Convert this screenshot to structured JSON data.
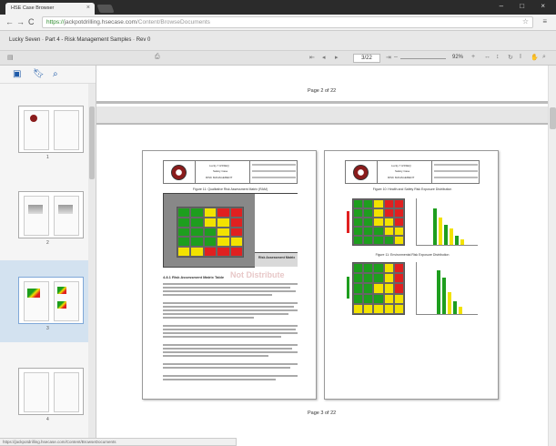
{
  "browser": {
    "tab_title": "HSE Case Browser",
    "tab_close": "×",
    "window_controls": "– □ ×",
    "back": "←",
    "forward": "→",
    "reload": "C",
    "url_scheme": "https://",
    "url_host": "jackpotdrilling.hsecase.com",
    "url_path": "/Content/BrowseDocuments",
    "star_glyph": "☆",
    "menu_glyph": "≡",
    "status_url": "https://jackpotdrilling.hsecase.com/Content/BrowseDocuments"
  },
  "document": {
    "title": "Lucky Seven · Part 4 - Risk Management Samples · Rev 0"
  },
  "viewer": {
    "page_current": "3/22",
    "zoom": "92%",
    "page_caption_top": "Page 2 of 22",
    "page_caption_bottom": "Page 3 of 22",
    "icons": [
      "sidebar-toggle-icon",
      "print-icon",
      "first-page-icon",
      "prev-page-icon",
      "next-page-icon",
      "last-page-icon",
      "zoom-out-icon",
      "zoom-in-icon",
      "fit-width-icon",
      "fit-page-icon",
      "rotate-icon",
      "select-tool-icon",
      "hand-tool-icon"
    ]
  },
  "sidebar": {
    "tools": [
      "image-icon",
      "bookmark-icon",
      "search-icon"
    ],
    "thumbnails": [
      {
        "label": "1"
      },
      {
        "label": "2"
      },
      {
        "label": "3"
      },
      {
        "label": "4"
      }
    ]
  },
  "page_left": {
    "company": "Lucky 7 HSSEQ",
    "sub1": "Safety Case",
    "sub2": "RISK MANAGEMENT",
    "figure_caption": "Figure 11: Qualitative Risk Assessment Matrix (RAM)",
    "section_heading": "4.8.1   Risk Assessment Matrix Table",
    "watermark": "Not Distribute",
    "right_labels": [
      "Risk Assessment Matrix"
    ]
  },
  "page_right": {
    "company": "Lucky 7 HSSEQ",
    "sub1": "Safety Case",
    "sub2": "RISK MANAGEMENT",
    "caption1": "Figure 10: Health and Safety Risk Exposure Distribution",
    "caption2": "Figure 11: Environmental Risk Exposure Distribution"
  },
  "colors": {
    "red": "#e02020",
    "yellow": "#f2e200",
    "green": "#1e9e1e",
    "grey": "#777777",
    "brand_blue": "#1e5aa8"
  }
}
